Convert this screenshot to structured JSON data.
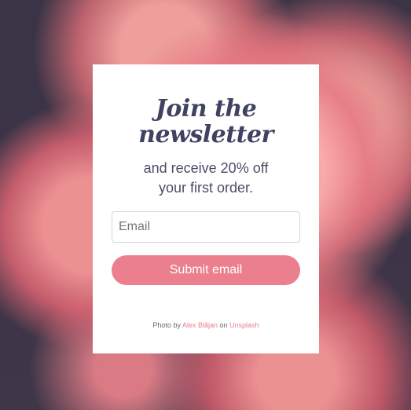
{
  "colors": {
    "accent": "#ec7f8e",
    "title": "#3f4260",
    "background": "#3a3446"
  },
  "newsletter": {
    "title": "Join the newsletter",
    "subtitle": "and receive 20% off your first order.",
    "email_placeholder": "Email",
    "email_value": "",
    "submit_label": "Submit email"
  },
  "credit": {
    "prefix": "Photo by",
    "author": "Alex Blăjan",
    "middle": "on",
    "source": "Unsplash"
  }
}
